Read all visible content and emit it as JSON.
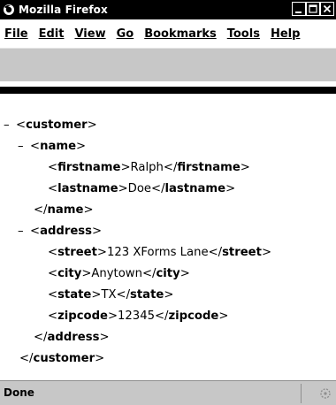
{
  "window": {
    "title": "Mozilla Firefox"
  },
  "menubar": {
    "items": [
      {
        "label": "File"
      },
      {
        "label": "Edit"
      },
      {
        "label": "View"
      },
      {
        "label": "Go"
      },
      {
        "label": "Bookmarks"
      },
      {
        "label": "Tools"
      },
      {
        "label": "Help"
      }
    ]
  },
  "xml": {
    "collapse": "–",
    "lines": [
      {
        "pre": "<",
        "tag": "customer",
        "post": ">"
      },
      {
        "pre": "<",
        "tag": "name",
        "post": ">"
      },
      {
        "pre": "<",
        "tag": "firstname",
        "mid": ">",
        "text": "Ralph",
        "close_pre": "</",
        "close_tag": "firstname",
        "close_post": ">"
      },
      {
        "pre": "<",
        "tag": "lastname",
        "mid": ">",
        "text": "Doe",
        "close_pre": "</",
        "close_tag": "lastname",
        "close_post": ">"
      },
      {
        "pre": "</",
        "tag": "name",
        "post": ">"
      },
      {
        "pre": "<",
        "tag": "address",
        "post": ">"
      },
      {
        "pre": "<",
        "tag": "street",
        "mid": ">",
        "text": "123 XForms Lane",
        "close_pre": "</",
        "close_tag": "street",
        "close_post": ">"
      },
      {
        "pre": "<",
        "tag": "city",
        "mid": ">",
        "text": "Anytown",
        "close_pre": "</",
        "close_tag": "city",
        "close_post": ">"
      },
      {
        "pre": "<",
        "tag": "state",
        "mid": ">",
        "text": "TX",
        "close_pre": "</",
        "close_tag": "state",
        "close_post": ">"
      },
      {
        "pre": "<",
        "tag": "zipcode",
        "mid": ">",
        "text": "12345",
        "close_pre": "</",
        "close_tag": "zipcode",
        "close_post": ">"
      },
      {
        "pre": "</",
        "tag": "address",
        "post": ">"
      },
      {
        "pre": "</",
        "tag": "customer",
        "post": ">"
      }
    ]
  },
  "statusbar": {
    "text": "Done"
  }
}
